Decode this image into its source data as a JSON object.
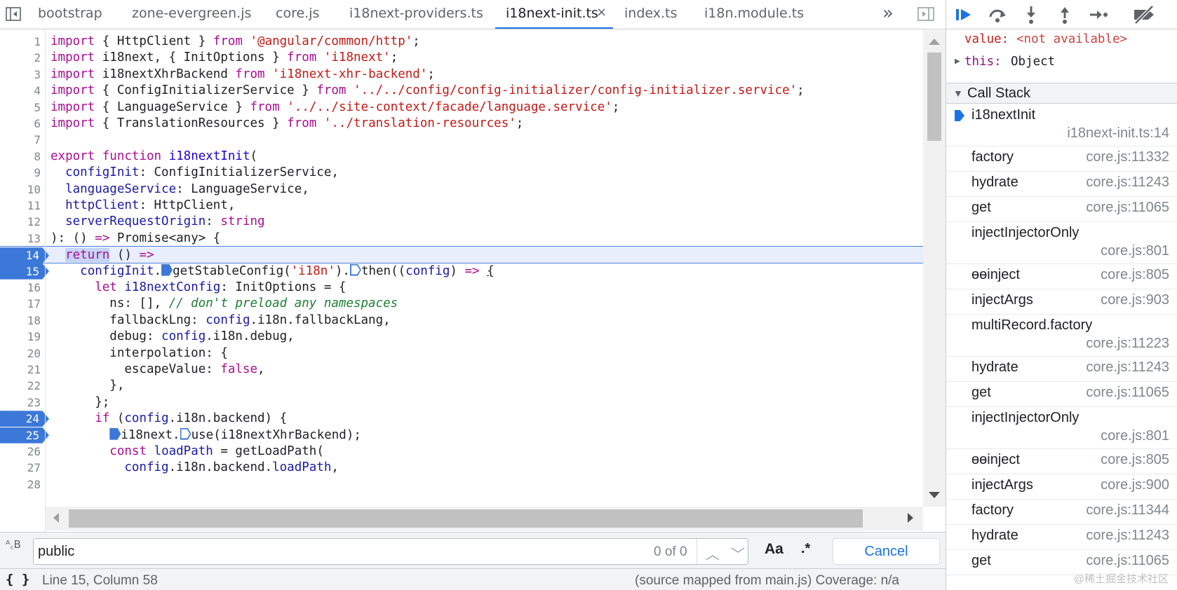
{
  "tabs": [
    {
      "label": "bootstrap",
      "active": false
    },
    {
      "label": "zone-evergreen.js",
      "active": false
    },
    {
      "label": "core.js",
      "active": false
    },
    {
      "label": "i18next-providers.ts",
      "active": false
    },
    {
      "label": "i18next-init.ts",
      "active": true
    },
    {
      "label": "index.ts",
      "active": false
    },
    {
      "label": "i18n.module.ts",
      "active": false
    }
  ],
  "tab_close_glyph": "×",
  "more_tabs_glyph": "»",
  "editor": {
    "current_line": 14,
    "breakpoints": [
      14,
      15,
      24,
      25
    ],
    "lines": [
      {
        "n": "1",
        "text": "import { HttpClient } from '@angular/common/http';"
      },
      {
        "n": "2",
        "text": "import i18next, { InitOptions } from 'i18next';"
      },
      {
        "n": "3",
        "text": "import i18nextXhrBackend from 'i18next-xhr-backend';"
      },
      {
        "n": "4",
        "text": "import { ConfigInitializerService } from '../../config/config-initializer/config-initializer.service';"
      },
      {
        "n": "5",
        "text": "import { LanguageService } from '../../site-context/facade/language.service';"
      },
      {
        "n": "6",
        "text": "import { TranslationResources } from '../translation-resources';"
      },
      {
        "n": "7",
        "text": ""
      },
      {
        "n": "8",
        "text": "export function i18nextInit("
      },
      {
        "n": "9",
        "text": "  configInit: ConfigInitializerService,"
      },
      {
        "n": "10",
        "text": "  languageService: LanguageService,"
      },
      {
        "n": "11",
        "text": "  httpClient: HttpClient,"
      },
      {
        "n": "12",
        "text": "  serverRequestOrigin: string"
      },
      {
        "n": "13",
        "text": "): () => Promise<any> {"
      },
      {
        "n": "14",
        "text": "  return () =>"
      },
      {
        "n": "15",
        "text": "    configInit.getStableConfig('i18n').then((config) => {"
      },
      {
        "n": "16",
        "text": "      let i18nextConfig: InitOptions = {"
      },
      {
        "n": "17",
        "text": "        ns: [], // don't preload any namespaces"
      },
      {
        "n": "18",
        "text": "        fallbackLng: config.i18n.fallbackLang,"
      },
      {
        "n": "19",
        "text": "        debug: config.i18n.debug,"
      },
      {
        "n": "20",
        "text": "        interpolation: {"
      },
      {
        "n": "21",
        "text": "          escapeValue: false,"
      },
      {
        "n": "22",
        "text": "        },"
      },
      {
        "n": "23",
        "text": "      };"
      },
      {
        "n": "24",
        "text": "      if (config.i18n.backend) {"
      },
      {
        "n": "25",
        "text": "        i18next.use(i18nextXhrBackend);"
      },
      {
        "n": "26",
        "text": "        const loadPath = getLoadPath("
      },
      {
        "n": "27",
        "text": "          config.i18n.backend.loadPath,"
      },
      {
        "n": "28",
        "text": ""
      }
    ]
  },
  "search": {
    "icon_text": "ᴬ꜀B",
    "value": "public",
    "count": "0 of 0",
    "prev_glyph": "︿",
    "next_glyph": "﹀",
    "case_label": "Aa",
    "regex_label": ".*",
    "cancel_label": "Cancel"
  },
  "status": {
    "braces": "{ }",
    "position": "Line 15, Column 58",
    "source_map": "(source mapped from main.js)  Coverage: n/a"
  },
  "debugger": {
    "scope": {
      "value_label": "value:",
      "value_text": "<not available>",
      "this_label": "this:",
      "this_value": "Object"
    },
    "call_stack_title": "Call Stack",
    "frames": [
      {
        "name": "i18nextInit",
        "loc": "i18next-init.ts:14",
        "current": true
      },
      {
        "name": "factory",
        "loc": "core.js:11332"
      },
      {
        "name": "hydrate",
        "loc": "core.js:11243"
      },
      {
        "name": "get",
        "loc": "core.js:11065"
      },
      {
        "name": "injectInjectorOnly",
        "loc": "core.js:801"
      },
      {
        "name": "ɵɵinject",
        "loc": "core.js:805"
      },
      {
        "name": "injectArgs",
        "loc": "core.js:903"
      },
      {
        "name": "multiRecord.factory",
        "loc": "core.js:11223"
      },
      {
        "name": "hydrate",
        "loc": "core.js:11243"
      },
      {
        "name": "get",
        "loc": "core.js:11065"
      },
      {
        "name": "injectInjectorOnly",
        "loc": "core.js:801"
      },
      {
        "name": "ɵɵinject",
        "loc": "core.js:805"
      },
      {
        "name": "injectArgs",
        "loc": "core.js:900"
      },
      {
        "name": "factory",
        "loc": "core.js:11344"
      },
      {
        "name": "hydrate",
        "loc": "core.js:11243"
      },
      {
        "name": "get",
        "loc": "core.js:11065"
      }
    ],
    "watermark": "@稀土掘金技术社区"
  },
  "colors": {
    "accent": "#1a73e8",
    "breakpoint": "#3c78d8",
    "keyword": "#aa0d91",
    "string": "#c41a16",
    "comment": "#1e7e34",
    "current_line_bg": "#e8eefc"
  }
}
